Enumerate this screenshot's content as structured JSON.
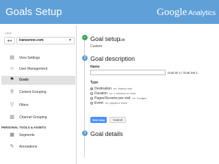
{
  "header": {
    "title": "Goals Setup",
    "brand_google": "Google",
    "brand_analytics": "Analytics"
  },
  "sidebar": {
    "view_label": "VIEW",
    "back_icon": "back-arrow-icon",
    "account": "iranserver.com",
    "items": [
      {
        "label": "View Settings",
        "icon": "document-icon"
      },
      {
        "label": "User Management",
        "icon": "users-icon"
      },
      {
        "label": "Goals",
        "icon": "flag-icon"
      },
      {
        "label": "Content Grouping",
        "icon": "grouping-icon"
      },
      {
        "label": "Filters",
        "icon": "filter-icon"
      },
      {
        "label": "Channel Grouping",
        "icon": "channel-icon"
      }
    ],
    "section_title": "PERSONAL TOOLS & ASSETS",
    "tools": [
      {
        "label": "Segments",
        "icon": "segments-icon"
      },
      {
        "label": "Annotations",
        "icon": "annotations-icon"
      }
    ]
  },
  "main": {
    "goal_setup": {
      "title": "Goal setup",
      "edit": "Edit",
      "value": "Custom"
    },
    "goal_description": {
      "step": "2",
      "title": "Goal description",
      "name_label": "Name",
      "name_value": "",
      "goal_id": "Goal ID 2 / Goal Set 1",
      "type_label": "Type",
      "types": [
        {
          "label": "Destination",
          "example": "ex: thanks.html",
          "checked": true
        },
        {
          "label": "Duration",
          "example": "ex: 5 minutes or more",
          "checked": false
        },
        {
          "label": "Pages/Screens per visit",
          "example": "ex: 3 pages",
          "checked": false
        },
        {
          "label": "Event",
          "example": "ex: played a video",
          "checked": false
        }
      ],
      "next_button": "Next step",
      "cancel_button": "Cancel"
    },
    "goal_details": {
      "step": "3",
      "title": "Goal details"
    }
  },
  "colors": {
    "header_bg": "#60a0d8",
    "step_done": "#3aa757",
    "step_active": "#5b9bd5",
    "primary_button": "#4d90fe"
  }
}
